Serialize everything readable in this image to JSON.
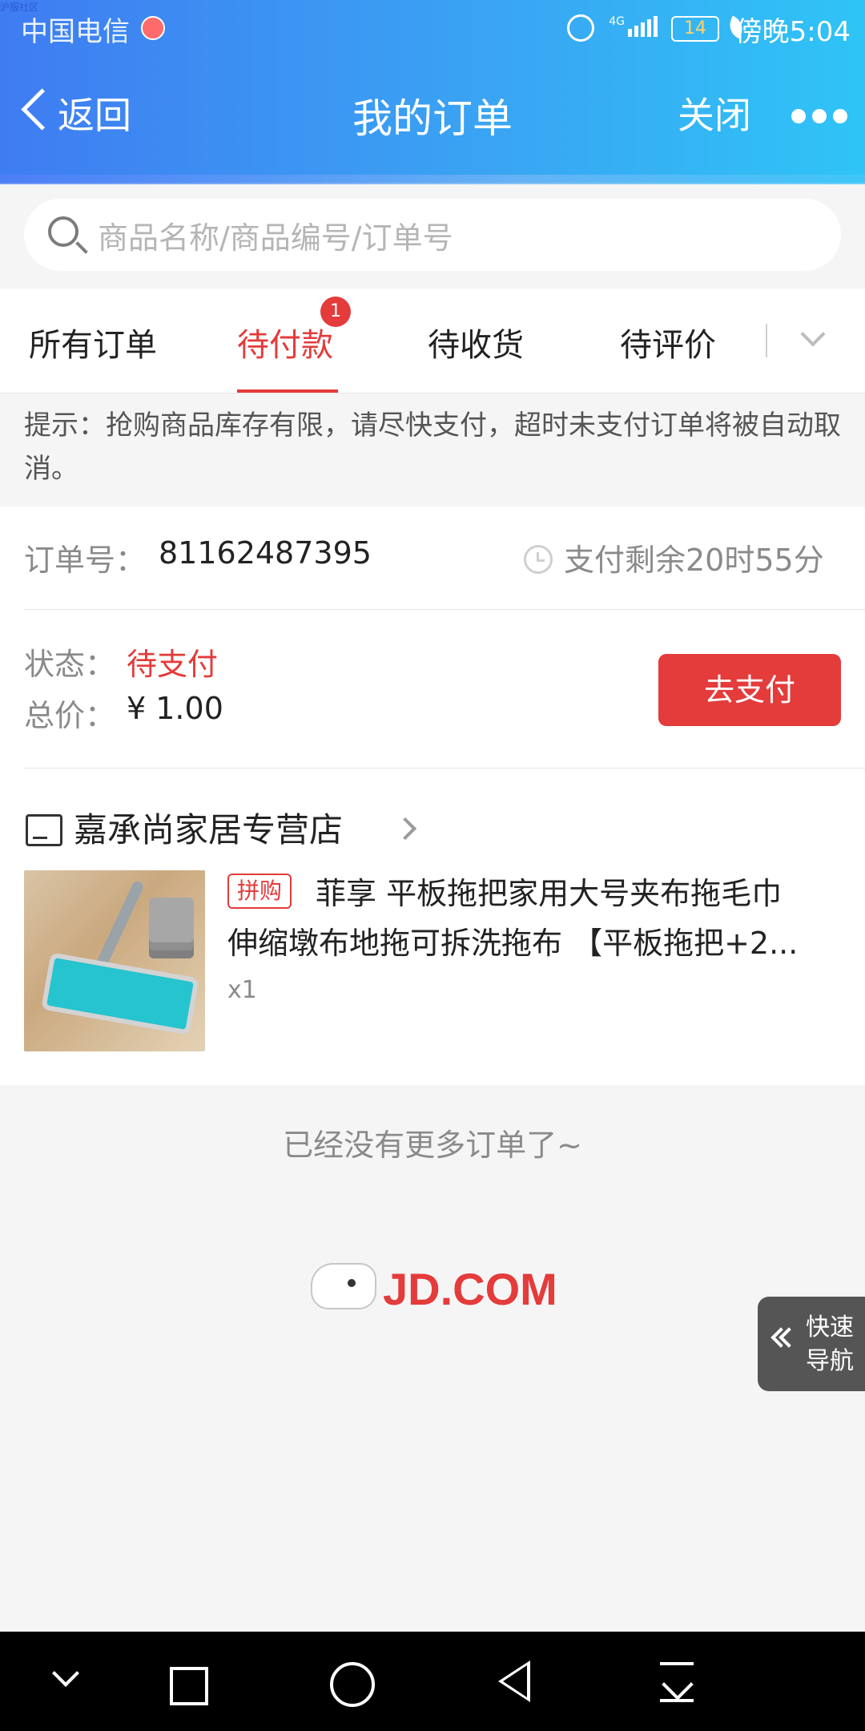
{
  "status_bar": {
    "tiny_text": "沪服社区",
    "carrier": "中国电信",
    "network": "4G",
    "battery": "14",
    "time": "傍晚5:04"
  },
  "header": {
    "back": "返回",
    "title": "我的订单",
    "close": "关闭"
  },
  "search": {
    "placeholder": "商品名称/商品编号/订单号"
  },
  "tabs": {
    "items": [
      {
        "label": "所有订单"
      },
      {
        "label": "待付款",
        "badge": "1"
      },
      {
        "label": "待收货"
      },
      {
        "label": "待评价"
      }
    ]
  },
  "tip": {
    "text": "提示：抢购商品库存有限，请尽快支付，超时未支付订单将被自动取消。"
  },
  "order": {
    "order_no_label": "订单号：",
    "order_no": "81162487395",
    "countdown": "支付剩余20时55分",
    "status_label": "状态：",
    "status_value": "待支付",
    "total_label": "总价：",
    "total_value": "¥ 1.00",
    "pay_button": "去支付",
    "store_name": "嘉承尚家居专营店",
    "product_tag": "拼购",
    "product_line1": "菲享 平板拖把家用大号夹布拖毛巾",
    "product_line2": "伸缩墩布地拖可拆洗拖布 【平板拖把+2...",
    "qty": "x1"
  },
  "footer": {
    "no_more": "已经没有更多订单了~",
    "logo_text": "JD.COM",
    "quick_nav": "快速导航"
  },
  "colors": {
    "accent_red": "#e43b3b",
    "header_blue_start": "#3f7cf2",
    "header_blue_end": "#2fc4f6"
  }
}
